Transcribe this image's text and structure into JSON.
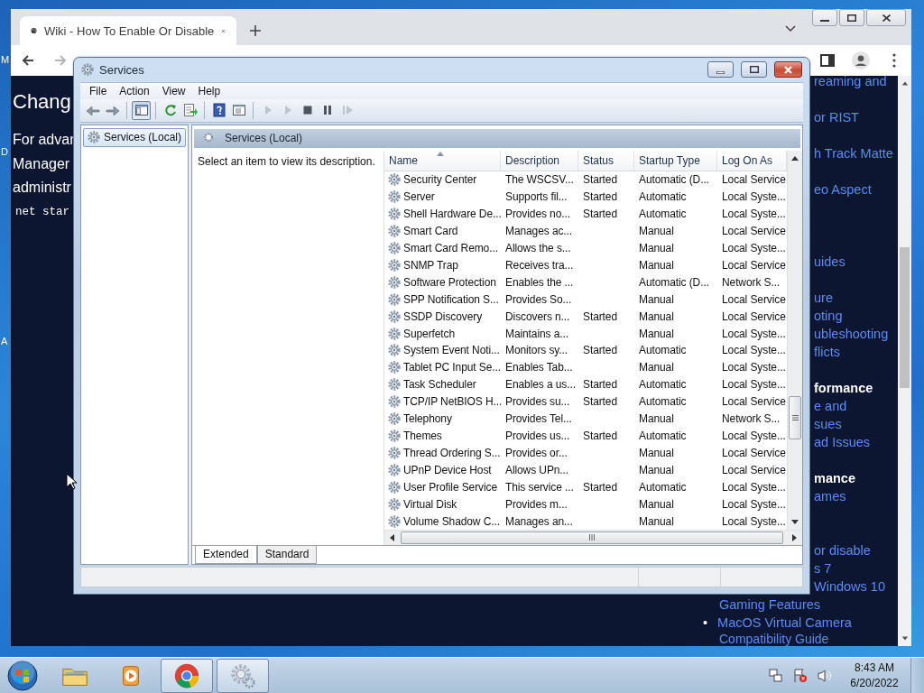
{
  "desktop": {
    "edge_letters": [
      "M",
      "D",
      "A"
    ]
  },
  "browser": {
    "tabs": [
      {
        "title": "Wiki - How To Enable Or Disable",
        "selected": true
      }
    ],
    "nav_buttons": [
      {
        "kind": "back",
        "disabled": false
      },
      {
        "kind": "forward",
        "disabled": true
      }
    ],
    "action_buttons": [
      {
        "kind": "sidebar"
      },
      {
        "kind": "profile"
      },
      {
        "kind": "menu"
      }
    ],
    "page": {
      "left_column": [
        {
          "kind": "heading",
          "text": "Chang"
        },
        {
          "kind": "para",
          "text": "For advar"
        },
        {
          "kind": "para",
          "text": "Manager"
        },
        {
          "kind": "para",
          "text": "administr"
        },
        {
          "kind": "code",
          "text": "net star"
        }
      ],
      "right_column": [
        {
          "kind": "link",
          "covered": true,
          "text": "reaming and"
        },
        {
          "kind": "link",
          "covered": true,
          "text": "or RIST"
        },
        {
          "kind": "link",
          "covered": true,
          "text": "h Track Matte"
        },
        {
          "kind": "link",
          "covered": true,
          "text": "eo Aspect"
        },
        {
          "kind": "link",
          "covered": true,
          "text": "uides"
        },
        {
          "kind": "link",
          "covered": true,
          "text": "ure"
        },
        {
          "kind": "link",
          "covered": true,
          "text": "oting"
        },
        {
          "kind": "link",
          "covered": true,
          "text": "ubleshooting"
        },
        {
          "kind": "link",
          "covered": true,
          "text": "flicts"
        },
        {
          "kind": "heading",
          "covered": true,
          "text": "formance"
        },
        {
          "kind": "link",
          "covered": true,
          "text": "e and"
        },
        {
          "kind": "link",
          "covered": true,
          "text": "sues"
        },
        {
          "kind": "link",
          "covered": true,
          "text": "ad Issues"
        },
        {
          "kind": "heading",
          "covered": true,
          "text": "mance"
        },
        {
          "kind": "link",
          "covered": true,
          "text": "ames"
        },
        {
          "kind": "link",
          "covered": true,
          "text": "or disable"
        },
        {
          "kind": "link",
          "covered": true,
          "text": "s 7"
        },
        {
          "kind": "link",
          "covered": true,
          "text": "Windows 10"
        },
        {
          "kind": "link",
          "covered": false,
          "text": "Gaming Features"
        },
        {
          "kind": "bullet",
          "covered": false,
          "bullet": "•",
          "text": "MacOS Virtual Camera"
        },
        {
          "kind": "link",
          "covered": false,
          "text": "Compatibility Guide"
        }
      ]
    }
  },
  "services_window": {
    "title": "Services",
    "menu": [
      "File",
      "Action",
      "View",
      "Help"
    ],
    "toolbar": [
      {
        "kind": "back",
        "disabled": false,
        "pressed": false
      },
      {
        "kind": "forward",
        "disabled": false,
        "pressed": false
      },
      {
        "kind": "separator"
      },
      {
        "kind": "tree",
        "disabled": false,
        "pressed": true
      },
      {
        "kind": "separator"
      },
      {
        "kind": "refresh",
        "disabled": false,
        "pressed": false
      },
      {
        "kind": "export",
        "disabled": false,
        "pressed": false
      },
      {
        "kind": "separator"
      },
      {
        "kind": "help",
        "disabled": false,
        "pressed": false
      },
      {
        "kind": "properties",
        "disabled": false,
        "pressed": false
      },
      {
        "kind": "separator"
      },
      {
        "kind": "start",
        "disabled": true,
        "pressed": false
      },
      {
        "kind": "start",
        "disabled": true,
        "pressed": false
      },
      {
        "kind": "stop",
        "disabled": false,
        "pressed": false
      },
      {
        "kind": "pause",
        "disabled": false,
        "pressed": false
      },
      {
        "kind": "resume",
        "disabled": true,
        "pressed": false
      }
    ],
    "tree": [
      {
        "label": "Services (Local)",
        "selected": true
      }
    ],
    "pane_title": "Services (Local)",
    "description_hint": "Select an item to view its description.",
    "columns": [
      {
        "label": "Name",
        "sorted": true
      },
      {
        "label": "Description",
        "sorted": false
      },
      {
        "label": "Status",
        "sorted": false
      },
      {
        "label": "Startup Type",
        "sorted": false
      },
      {
        "label": "Log On As",
        "sorted": false
      }
    ],
    "rows": [
      {
        "name": "Security Center",
        "description": "The WSCSV...",
        "status": "Started",
        "startup_type": "Automatic (D...",
        "log_on_as": "Local Service"
      },
      {
        "name": "Server",
        "description": "Supports fil...",
        "status": "Started",
        "startup_type": "Automatic",
        "log_on_as": "Local Syste..."
      },
      {
        "name": "Shell Hardware De...",
        "description": "Provides no...",
        "status": "Started",
        "startup_type": "Automatic",
        "log_on_as": "Local Syste..."
      },
      {
        "name": "Smart Card",
        "description": "Manages ac...",
        "startup_type": "Manual",
        "log_on_as": "Local Service"
      },
      {
        "name": "Smart Card Remo...",
        "description": "Allows the s...",
        "startup_type": "Manual",
        "log_on_as": "Local Syste..."
      },
      {
        "name": "SNMP Trap",
        "description": "Receives tra...",
        "startup_type": "Manual",
        "log_on_as": "Local Service"
      },
      {
        "name": "Software Protection",
        "description": "Enables the ...",
        "startup_type": "Automatic (D...",
        "log_on_as": "Network S..."
      },
      {
        "name": "SPP Notification S...",
        "description": "Provides So...",
        "startup_type": "Manual",
        "log_on_as": "Local Service"
      },
      {
        "name": "SSDP Discovery",
        "description": "Discovers n...",
        "status": "Started",
        "startup_type": "Manual",
        "log_on_as": "Local Service"
      },
      {
        "name": "Superfetch",
        "description": "Maintains a...",
        "startup_type": "Manual",
        "log_on_as": "Local Syste..."
      },
      {
        "name": "System Event Noti...",
        "description": "Monitors sy...",
        "status": "Started",
        "startup_type": "Automatic",
        "log_on_as": "Local Syste..."
      },
      {
        "name": "Tablet PC Input Se...",
        "description": "Enables Tab...",
        "startup_type": "Manual",
        "log_on_as": "Local Syste..."
      },
      {
        "name": "Task Scheduler",
        "description": "Enables a us...",
        "status": "Started",
        "startup_type": "Automatic",
        "log_on_as": "Local Syste..."
      },
      {
        "name": "TCP/IP NetBIOS H...",
        "description": "Provides su...",
        "status": "Started",
        "startup_type": "Automatic",
        "log_on_as": "Local Service"
      },
      {
        "name": "Telephony",
        "description": "Provides Tel...",
        "startup_type": "Manual",
        "log_on_as": "Network S..."
      },
      {
        "name": "Themes",
        "description": "Provides us...",
        "status": "Started",
        "startup_type": "Automatic",
        "log_on_as": "Local Syste..."
      },
      {
        "name": "Thread Ordering S...",
        "description": "Provides or...",
        "startup_type": "Manual",
        "log_on_as": "Local Service"
      },
      {
        "name": "UPnP Device Host",
        "description": "Allows UPn...",
        "startup_type": "Manual",
        "log_on_as": "Local Service"
      },
      {
        "name": "User Profile Service",
        "description": "This service ...",
        "status": "Started",
        "startup_type": "Automatic",
        "log_on_as": "Local Syste..."
      },
      {
        "name": "Virtual Disk",
        "description": "Provides m...",
        "startup_type": "Manual",
        "log_on_as": "Local Syste..."
      },
      {
        "name": "Volume Shadow C...",
        "description": "Manages an...",
        "startup_type": "Manual",
        "log_on_as": "Local Syste..."
      }
    ],
    "view_tabs": [
      {
        "label": "Extended",
        "selected": true
      },
      {
        "label": "Standard",
        "selected": false
      }
    ]
  },
  "taskbar": {
    "items": [
      {
        "kind": "explorer",
        "running": false
      },
      {
        "kind": "media",
        "running": false
      },
      {
        "kind": "chrome",
        "running": true
      },
      {
        "kind": "services",
        "running": true
      }
    ],
    "tray": [
      {
        "kind": "network"
      },
      {
        "kind": "flag"
      },
      {
        "kind": "volume"
      }
    ],
    "time": "8:43 AM",
    "date": "6/20/2022"
  }
}
